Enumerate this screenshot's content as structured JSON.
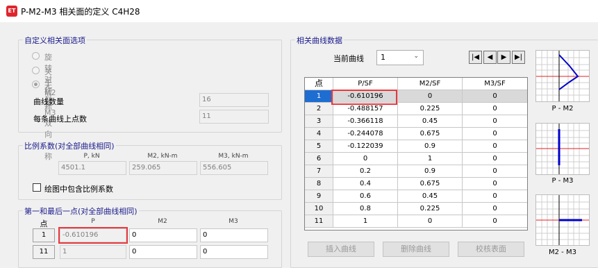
{
  "window": {
    "app_icon_text": "ET",
    "title": "P-M2-M3 相关面的定义 C4H28"
  },
  "custom_options": {
    "title": "自定义相关面选项",
    "radios": [
      "旋转对称",
      "关于M2和M3双向对称",
      "无对称"
    ],
    "selected_radio": 2,
    "curve_count_label": "曲线数量",
    "curve_count_value": "16",
    "points_per_curve_label": "每条曲线上点数",
    "points_per_curve_value": "11"
  },
  "scale": {
    "title": "比例系数(对全部曲线相同)",
    "headers": [
      "P, kN",
      "M2, kN-m",
      "M3, kN-m"
    ],
    "values": [
      "4501.1",
      "259.065",
      "556.605"
    ],
    "include_label": "绘图中包含比例系数",
    "include_checked": false
  },
  "endpoints": {
    "title": "第一和最后一点(对全部曲线相同)",
    "headers": [
      "点",
      "P",
      "M2",
      "M3"
    ],
    "rows": [
      {
        "point": "1",
        "p": "-0.610196",
        "m2": "0",
        "m3": "0"
      },
      {
        "point": "11",
        "p": "1",
        "m2": "0",
        "m3": "0"
      }
    ]
  },
  "curve_data": {
    "title": "相关曲线数据",
    "current_label": "当前曲线",
    "current_value": "1",
    "nav": [
      "first",
      "prev",
      "next",
      "last"
    ],
    "table_headers": [
      "点",
      "P/SF",
      "M2/SF",
      "M3/SF"
    ],
    "table_rows": [
      [
        "1",
        "-0.610196",
        "0",
        "0"
      ],
      [
        "2",
        "-0.488157",
        "0.225",
        "0"
      ],
      [
        "3",
        "-0.366118",
        "0.45",
        "0"
      ],
      [
        "4",
        "-0.244078",
        "0.675",
        "0"
      ],
      [
        "5",
        "-0.122039",
        "0.9",
        "0"
      ],
      [
        "6",
        "0",
        "1",
        "0"
      ],
      [
        "7",
        "0.2",
        "0.9",
        "0"
      ],
      [
        "8",
        "0.4",
        "0.675",
        "0"
      ],
      [
        "9",
        "0.6",
        "0.45",
        "0"
      ],
      [
        "10",
        "0.8",
        "0.225",
        "0"
      ],
      [
        "11",
        "1",
        "0",
        "0"
      ]
    ],
    "selected_row": 0,
    "buttons": [
      "插入曲线",
      "删除曲线",
      "校核表面"
    ]
  },
  "thumbnails": [
    {
      "caption": "P - M2"
    },
    {
      "caption": "P - M3"
    },
    {
      "caption": "M2 - M3"
    }
  ],
  "colors": {
    "accent": "#1e6ed2",
    "highlight": "#e8383f",
    "curve": "#0000cc"
  }
}
